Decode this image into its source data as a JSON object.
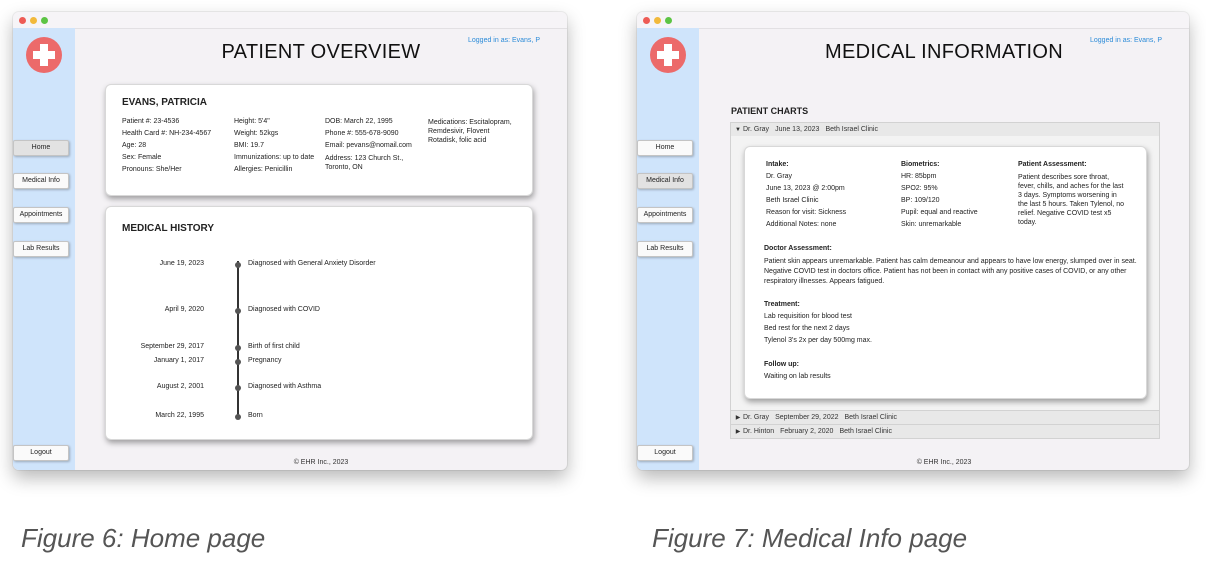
{
  "figures": [
    {
      "window": {
        "title": "PATIENT OVERVIEW",
        "logged_in": "Logged in as: Evans, P",
        "footer": "© EHR Inc., 2023",
        "nav": [
          "Home",
          "Medical Info",
          "Appointments",
          "Lab Results"
        ],
        "logout": "Logout",
        "patient": {
          "name": "EVANS, PATRICIA",
          "col1": [
            "Patient #: 23-4536",
            "Health Card #: NH-234-4567",
            "Age: 28",
            "Sex: Female",
            "Pronouns: She/Her"
          ],
          "col2": [
            "Height: 5'4\"",
            "Weight: 52kgs",
            "BMI: 19.7",
            "Immunizations: up to date",
            "Allergies: Penicillin"
          ],
          "col3": [
            "DOB: March 22, 1995",
            "Phone #: 555-678-9090",
            "Email: pevans@nomail.com",
            "Address: 123 Church St.,",
            "Toronto, ON"
          ],
          "col4": [
            "Medications: Escitalopram,",
            "Remdesivir, Flovent",
            "Rotadisk, folic acid"
          ]
        },
        "history": {
          "title": "MEDICAL HISTORY",
          "events": [
            {
              "date": "June 19, 2023",
              "desc": "Diagnosed with General Anxiety Disorder"
            },
            {
              "date": "April 9, 2020",
              "desc": "Diagnosed with COVID"
            },
            {
              "date": "September 29, 2017",
              "desc": "Birth of first child"
            },
            {
              "date": "January 1, 2017",
              "desc": "Pregnancy"
            },
            {
              "date": "August 2, 2001",
              "desc": "Diagnosed with Asthma"
            },
            {
              "date": "March 22, 1995",
              "desc": "Born"
            }
          ]
        }
      },
      "caption": "Figure 6: Home page"
    },
    {
      "window": {
        "title": "MEDICAL INFORMATION",
        "logged_in": "Logged in as: Evans, P",
        "footer": "© EHR Inc., 2023",
        "nav": [
          "Home",
          "Medical Info",
          "Appointments",
          "Lab Results"
        ],
        "logout": "Logout",
        "section": "PATIENT CHARTS",
        "charts": [
          {
            "doctor": "Dr. Gray",
            "date": "June 13, 2023",
            "clinic": "Beth Israel Clinic",
            "expanded": true
          },
          {
            "doctor": "Dr. Gray",
            "date": "September 29, 2022",
            "clinic": "Beth Israel Clinic",
            "expanded": false
          },
          {
            "doctor": "Dr. Hinton",
            "date": "February 2, 2020",
            "clinic": "Beth Israel Clinic",
            "expanded": false
          }
        ],
        "detail": {
          "intake_label": "Intake:",
          "intake": [
            "Dr. Gray",
            "June 13, 2023 @ 2:00pm",
            "Beth Israel Clinic",
            "Reason for visit: Sickness",
            "Additional Notes: none"
          ],
          "biometrics_label": "Biometrics:",
          "biometrics": [
            "HR: 85bpm",
            "SPO2: 95%",
            "BP: 109/120",
            "Pupil: equal and reactive",
            "Skin: unremarkable"
          ],
          "patient_assessment_label": "Patient Assessment:",
          "patient_assessment": [
            "Patient describes sore throat,",
            "fever, chills, and aches for the last",
            "3 days. Symptoms worsening in",
            "the last 5 hours. Taken Tylenol, no",
            "relief. Negative COVID test x5",
            "today."
          ],
          "doctor_assessment_label": "Doctor Assessment:",
          "doctor_assessment": [
            "Patient skin appears unremarkable. Patient has calm demeanour and appears to have low energy, slumped over in seat.",
            "Negative COVID test in doctors office. Patient has not been in contact with any positive cases of COVID, or any other",
            "respiratory illnesses. Appears fatigued."
          ],
          "treatment_label": "Treatment:",
          "treatment": [
            "Lab requisition for blood test",
            "Bed rest for the next 2 days",
            "Tylenol 3's 2x per day 500mg max."
          ],
          "followup_label": "Follow up:",
          "followup": [
            "Waiting on lab results"
          ]
        }
      },
      "caption": "Figure 7: Medical Info page"
    }
  ]
}
